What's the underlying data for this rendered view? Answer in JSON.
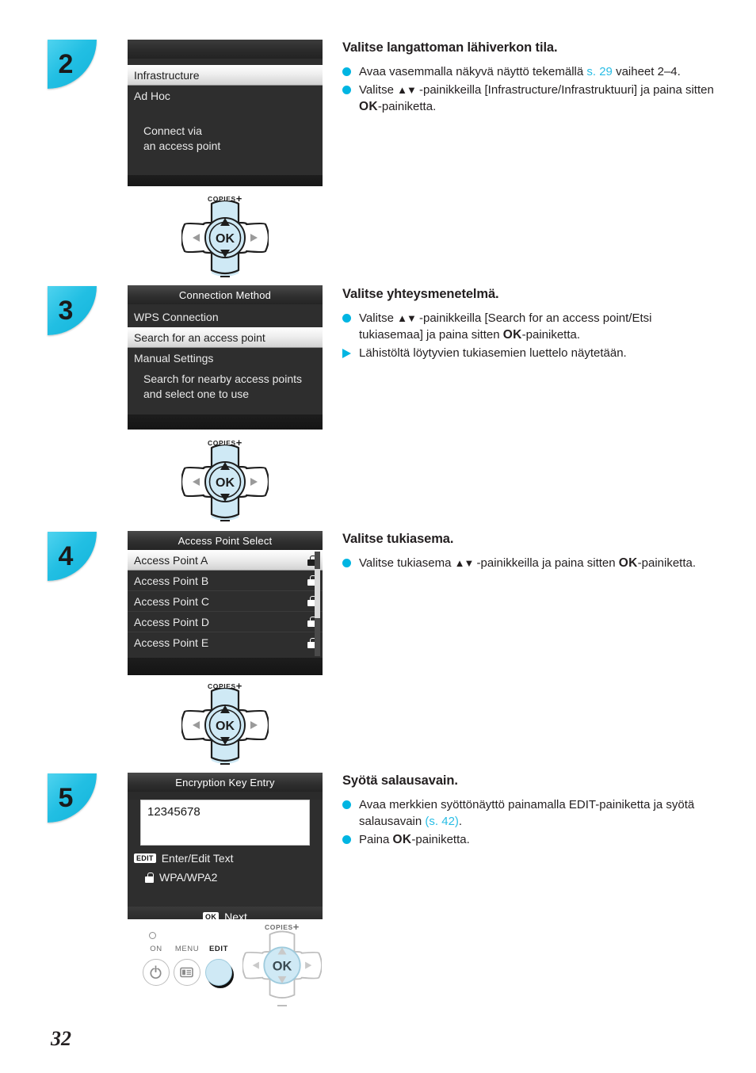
{
  "page": {
    "number": "32"
  },
  "steps": [
    {
      "badge": "2",
      "screen": {
        "kind": "list-no-title",
        "rows": [
          {
            "label": "Infrastructure",
            "selected": true
          },
          {
            "label": "Ad Hoc",
            "selected": false
          }
        ],
        "description": [
          "Connect via",
          "an access point"
        ]
      },
      "heading": "Valitse langattoman lähiverkon tila.",
      "bullets": [
        {
          "marker": "dot",
          "parts": [
            {
              "t": "Avaa vasemmalla näkyvä näyttö tekemällä ",
              "s": "n"
            },
            {
              "t": "s. 29",
              "s": "link"
            },
            {
              "t": " vaiheet 2–4.",
              "s": "n"
            }
          ]
        },
        {
          "marker": "dot",
          "parts": [
            {
              "t": "Valitse ",
              "s": "n"
            },
            {
              "t": "▲▼",
              "s": "arrows"
            },
            {
              "t": " -painikkeilla [Infrastructure/Infrastruktuuri] ja paina sitten ",
              "s": "n"
            },
            {
              "t": "OK",
              "s": "ok"
            },
            {
              "t": "-painiketta.",
              "s": "n"
            }
          ]
        }
      ],
      "pad": {
        "label": "COPIES",
        "plus": "+",
        "ok": "OK"
      }
    },
    {
      "badge": "3",
      "screen": {
        "kind": "list",
        "title": "Connection Method",
        "rows": [
          {
            "label": "WPS Connection",
            "selected": false
          },
          {
            "label": "Search for an access point",
            "selected": true
          },
          {
            "label": "Manual Settings",
            "selected": false
          }
        ],
        "description": [
          "Search for nearby access points",
          "and select one to use"
        ]
      },
      "heading": "Valitse yhteysmenetelmä.",
      "bullets": [
        {
          "marker": "dot",
          "parts": [
            {
              "t": "Valitse ",
              "s": "n"
            },
            {
              "t": "▲▼",
              "s": "arrows"
            },
            {
              "t": " -painikkeilla [Search for an access point/Etsi tukiasemaa] ja paina sitten ",
              "s": "n"
            },
            {
              "t": "OK",
              "s": "ok"
            },
            {
              "t": "-painiketta.",
              "s": "n"
            }
          ]
        },
        {
          "marker": "triangle",
          "parts": [
            {
              "t": "Lähistöltä löytyvien tukiasemien luettelo näytetään.",
              "s": "n"
            }
          ]
        }
      ],
      "pad": {
        "label": "COPIES",
        "plus": "+",
        "ok": "OK"
      }
    },
    {
      "badge": "4",
      "screen": {
        "kind": "access-points",
        "title": "Access Point Select",
        "rows": [
          {
            "label": "Access Point A",
            "selected": true,
            "locked": true
          },
          {
            "label": "Access Point B",
            "selected": false,
            "locked": true
          },
          {
            "label": "Access Point C",
            "selected": false,
            "locked": true
          },
          {
            "label": "Access Point D",
            "selected": false,
            "locked": true
          },
          {
            "label": "Access Point E",
            "selected": false,
            "locked": true
          }
        ]
      },
      "heading": "Valitse tukiasema.",
      "bullets": [
        {
          "marker": "dot",
          "parts": [
            {
              "t": "Valitse tukiasema ",
              "s": "n"
            },
            {
              "t": "▲▼",
              "s": "arrows"
            },
            {
              "t": " -painikkeilla ja paina sitten ",
              "s": "n"
            },
            {
              "t": "OK",
              "s": "ok"
            },
            {
              "t": "-painiketta.",
              "s": "n"
            }
          ]
        }
      ],
      "pad": {
        "label": "COPIES",
        "plus": "+",
        "ok": "OK"
      }
    },
    {
      "badge": "5",
      "screen": {
        "kind": "key-entry",
        "title": "Encryption Key Entry",
        "value": "12345678",
        "edit_tag": "EDIT",
        "edit_label": "Enter/Edit Text",
        "security": "WPA/WPA2",
        "footer_tag": "OK",
        "footer_label": "Next"
      },
      "heading": "Syötä salausavain.",
      "bullets": [
        {
          "marker": "dot",
          "parts": [
            {
              "t": "Avaa merkkien syöttönäyttö painamalla EDIT-painiketta ja syötä salausavain ",
              "s": "n"
            },
            {
              "t": "(s. 42)",
              "s": "link"
            },
            {
              "t": ".",
              "s": "n"
            }
          ]
        },
        {
          "marker": "dot",
          "parts": [
            {
              "t": "Paina ",
              "s": "n"
            },
            {
              "t": "OK",
              "s": "ok"
            },
            {
              "t": "-painiketta.",
              "s": "n"
            }
          ]
        }
      ],
      "panel": {
        "led": "power-led",
        "buttons": [
          {
            "label": "ON",
            "icon": "power-icon"
          },
          {
            "label": "MENU",
            "icon": "menu-icon"
          },
          {
            "label": "EDIT",
            "icon": "none"
          }
        ],
        "pad": {
          "label": "COPIES",
          "plus": "+",
          "ok": "OK"
        }
      }
    }
  ],
  "colors": {
    "accent": "#00b5e2",
    "link": "#29bde5",
    "badge": "#22bfe3",
    "text": "#231f20"
  }
}
